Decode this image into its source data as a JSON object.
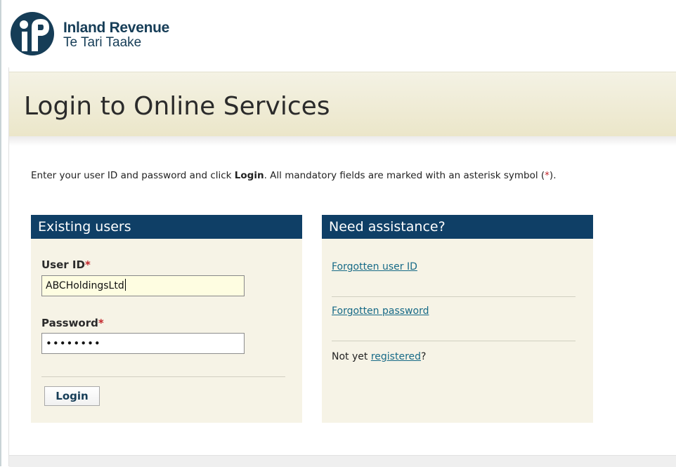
{
  "header": {
    "brand_name": "Inland Revenue",
    "brand_sub": "Te Tari Taake"
  },
  "page": {
    "title": "Login to Online Services",
    "intro_part1": "Enter your user ID and password and click ",
    "intro_bold": "Login",
    "intro_part2": ". All mandatory fields are marked with an asterisk symbol (",
    "asterisk": "*",
    "intro_part3": ")."
  },
  "existing_users": {
    "heading": "Existing users",
    "user_id_label": "User ID",
    "user_id_value": "ABCHoldingsLtd",
    "password_label": "Password",
    "password_value": "••••••••",
    "required_mark": "*",
    "login_button": "Login"
  },
  "assistance": {
    "heading": "Need assistance?",
    "forgot_user_id": "Forgotten user ID",
    "forgot_password": "Forgotten password",
    "not_yet_prefix": "Not yet ",
    "registered_link": "registered",
    "not_yet_suffix": "?"
  },
  "colors": {
    "brand_navy": "#0f3f66",
    "link_teal": "#176a87",
    "required_red": "#c3262b",
    "panel_bg": "#f6f3e6",
    "title_band": "#ebe6c9"
  },
  "icons": {
    "logo": "inland-revenue-logo-icon"
  }
}
